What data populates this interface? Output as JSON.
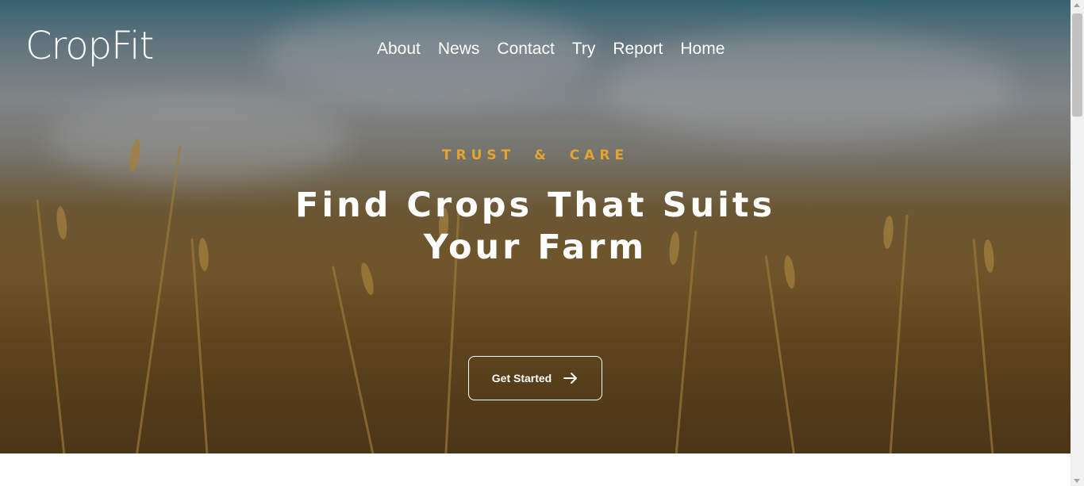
{
  "brand": {
    "name": "CropFit"
  },
  "nav": {
    "items": [
      {
        "label": "About"
      },
      {
        "label": "News"
      },
      {
        "label": "Contact"
      },
      {
        "label": "Try"
      },
      {
        "label": "Report"
      },
      {
        "label": "Home"
      }
    ]
  },
  "hero": {
    "eyebrow": "TRUST  &  CARE",
    "headline_line1": "Find Crops That Suits",
    "headline_line2": "Your Farm",
    "cta_label": "Get Started",
    "cta_icon": "arrow-right-icon",
    "background_image": "wheat-field-under-cloudy-sky"
  },
  "colors": {
    "accent": "#e2a62e",
    "text": "#ffffff",
    "page_bg": "#ffffff"
  }
}
